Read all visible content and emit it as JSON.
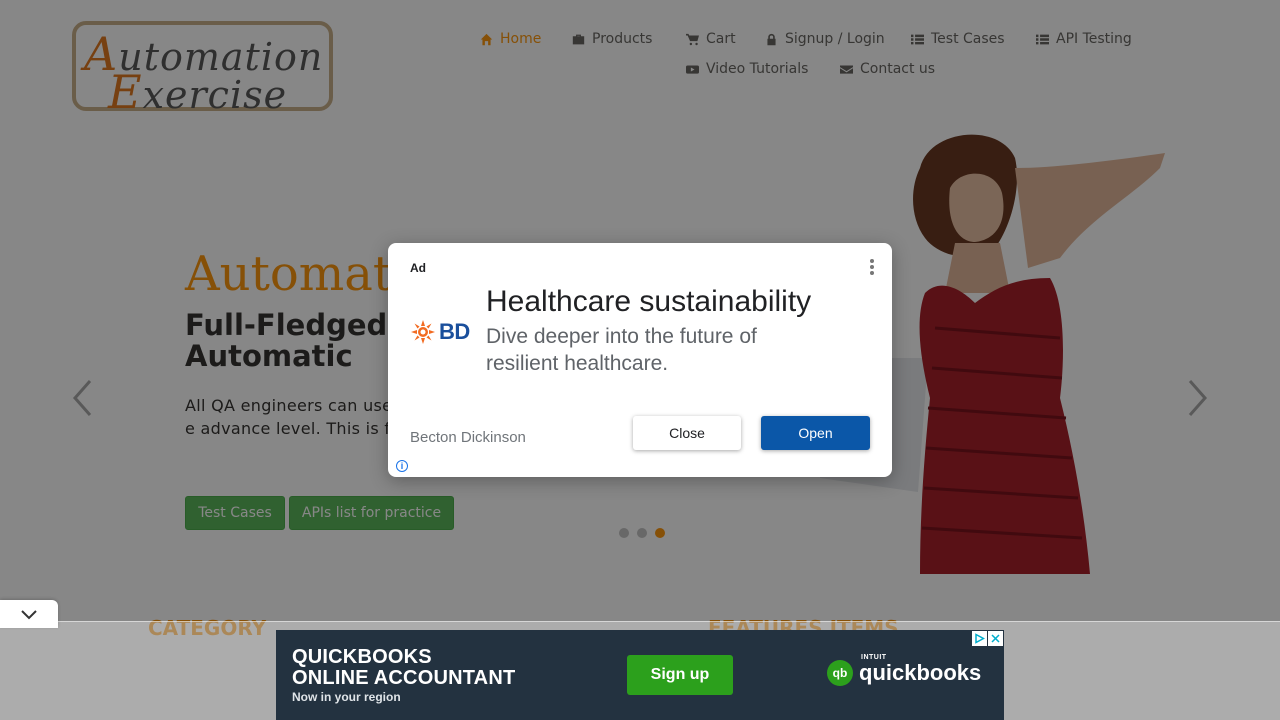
{
  "header": {
    "logo": {
      "line1": "Automation",
      "line2": "Exercise"
    },
    "nav": [
      {
        "label": "Home",
        "icon": "home-icon",
        "active": true
      },
      {
        "label": "Products",
        "icon": "briefcase-icon"
      },
      {
        "label": "Cart",
        "icon": "cart-icon"
      },
      {
        "label": "Signup / Login",
        "icon": "lock-icon"
      },
      {
        "label": "Test Cases",
        "icon": "list-icon"
      },
      {
        "label": "API Testing",
        "icon": "list-icon"
      },
      {
        "label": "Video Tutorials",
        "icon": "youtube-icon"
      },
      {
        "label": "Contact us",
        "icon": "envelope-icon"
      }
    ]
  },
  "slider": {
    "title": "Automat",
    "subtitle": "Full-Fledged for Automatic",
    "text": "All QA engineers can use practice and API testing e advance level. This is for their automation skills.",
    "buttons": {
      "test_cases": "Test Cases",
      "apis_list": "APIs list for practice"
    },
    "active_slide": 3,
    "slide_count": 3
  },
  "sections": {
    "category": "CATEGORY",
    "features": "FEATURES ITEMS"
  },
  "ad_dialog": {
    "label": "Ad",
    "brand": "BD",
    "headline": "Healthcare sustainability",
    "description": "Dive deeper into the future of resilient healthcare.",
    "advertiser": "Becton Dickinson",
    "close_label": "Close",
    "open_label": "Open"
  },
  "banner_ad": {
    "headline_line1": "QUICKBOOKS",
    "headline_line2": "ONLINE ACCOUNTANT",
    "subline": "Now in your region",
    "cta": "Sign up",
    "brand_small": "INTUIT",
    "brand": "quickbooks",
    "brand_mark": "qb"
  },
  "colors": {
    "accent": "#fe980f",
    "button_green": "#5cb85c",
    "ad_open_blue": "#0b57a8",
    "banner_bg": "#233240"
  }
}
